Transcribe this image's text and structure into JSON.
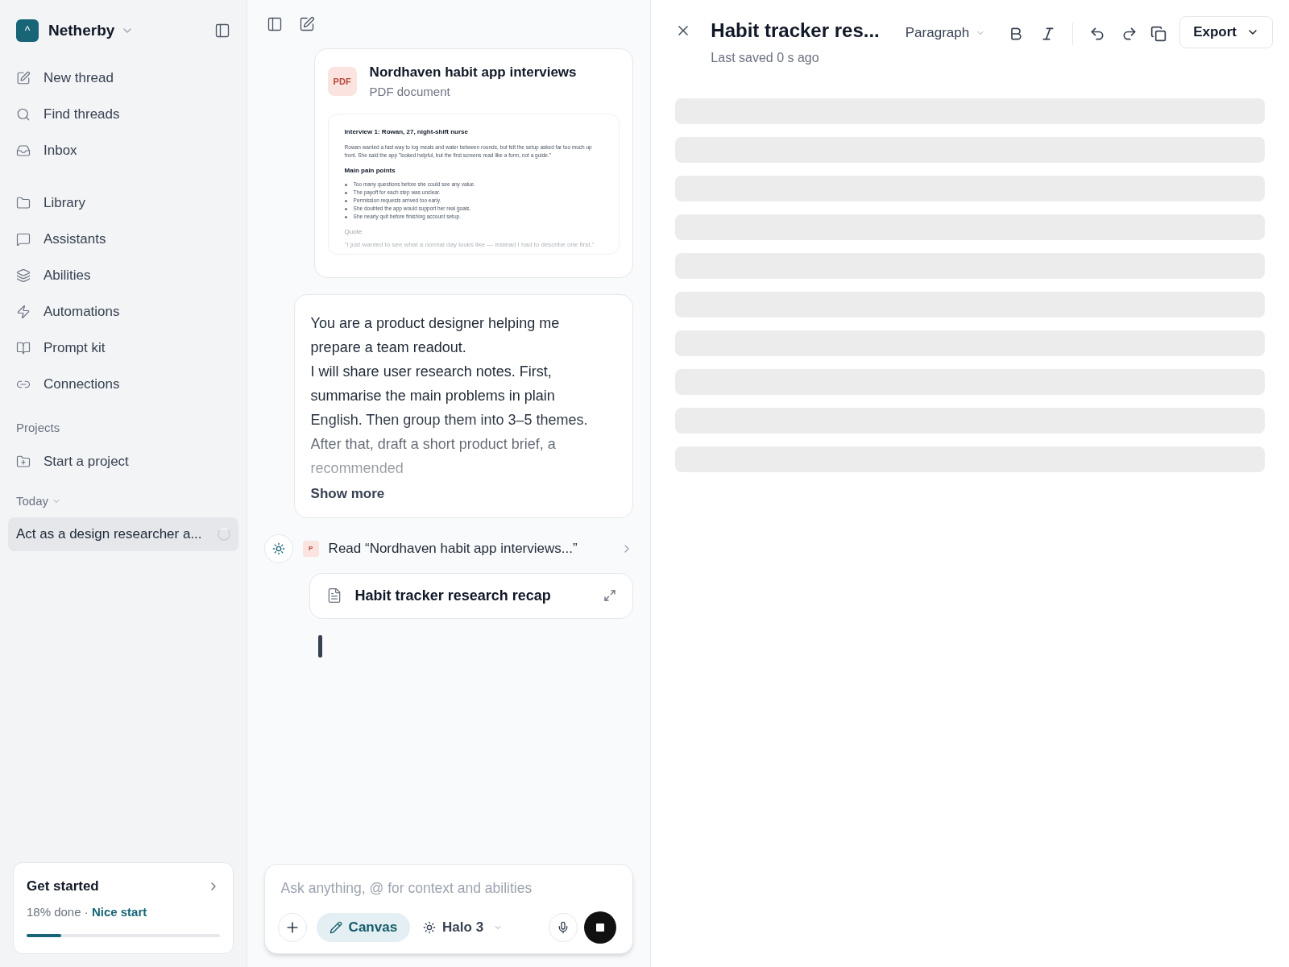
{
  "sidebar": {
    "workspace": {
      "initial": "^",
      "name": "Netherby"
    },
    "nav": [
      {
        "kind": "new",
        "label": "New thread"
      },
      {
        "kind": "search",
        "label": "Find threads"
      },
      {
        "kind": "inbox",
        "label": "Inbox"
      }
    ],
    "nav2": [
      {
        "kind": "library",
        "label": "Library"
      },
      {
        "kind": "assistants",
        "label": "Assistants"
      },
      {
        "kind": "abilities",
        "label": "Abilities"
      },
      {
        "kind": "automations",
        "label": "Automations"
      },
      {
        "kind": "prompt",
        "label": "Prompt kit"
      },
      {
        "kind": "connections",
        "label": "Connections"
      }
    ],
    "projects_heading": "Projects",
    "start_project": "Start a project",
    "today_heading": "Today",
    "threads": [
      {
        "title": "Act as a design researcher a...",
        "selected": true,
        "loading": true
      }
    ],
    "get_started": {
      "title": "Get started",
      "progress": "18% done",
      "separator": "·",
      "status": "Nice start",
      "level": 0.18
    }
  },
  "chat": {
    "attachment": {
      "badge": "PDF",
      "title": "Nordhaven habit app interviews",
      "subtitle": "PDF document",
      "preview": {
        "heading": "Interview 1: Rowan, 27, night-shift nurse",
        "body": "Rowan wanted a fast way to log meals and water between rounds, but felt the setup asked far too much up front. She said the app \"looked helpful, but the first screens read like a form, not a guide.\"",
        "subheading": "Main pain points",
        "bullets": [
          "Too many questions before she could see any value.",
          "The payoff for each step was unclear.",
          "Permission requests arrived too early.",
          "She doubted the app would support her real goals.",
          "She nearly quit before finishing account setup."
        ],
        "quote_heading": "Quote",
        "quote": "\"I just wanted to see what a normal day looks like — instead I had to describe one first.\""
      }
    },
    "message": {
      "lines": [
        "You are a product designer helping me prepare a team readout.",
        "I will share user research notes. First, summarise the main problems in plain English. Then group them into 3–5 themes. After that, draft a short product brief, a recommended"
      ],
      "show_more": "Show more"
    },
    "step": {
      "badge": "P",
      "text": "Read “Nordhaven habit app interviews...”"
    },
    "document": {
      "title": "Habit tracker research recap"
    },
    "streaming": true,
    "composer": {
      "placeholder": "Ask anything, @ for context and abilities",
      "mode": {
        "label": "Canvas",
        "on": true
      },
      "model": "Halo 3",
      "generating": true
    }
  },
  "editor": {
    "title": "Habit tracker res...",
    "saved": "Last saved 0 s ago",
    "block_type": "Paragraph",
    "export": "Export",
    "loading": true
  }
}
